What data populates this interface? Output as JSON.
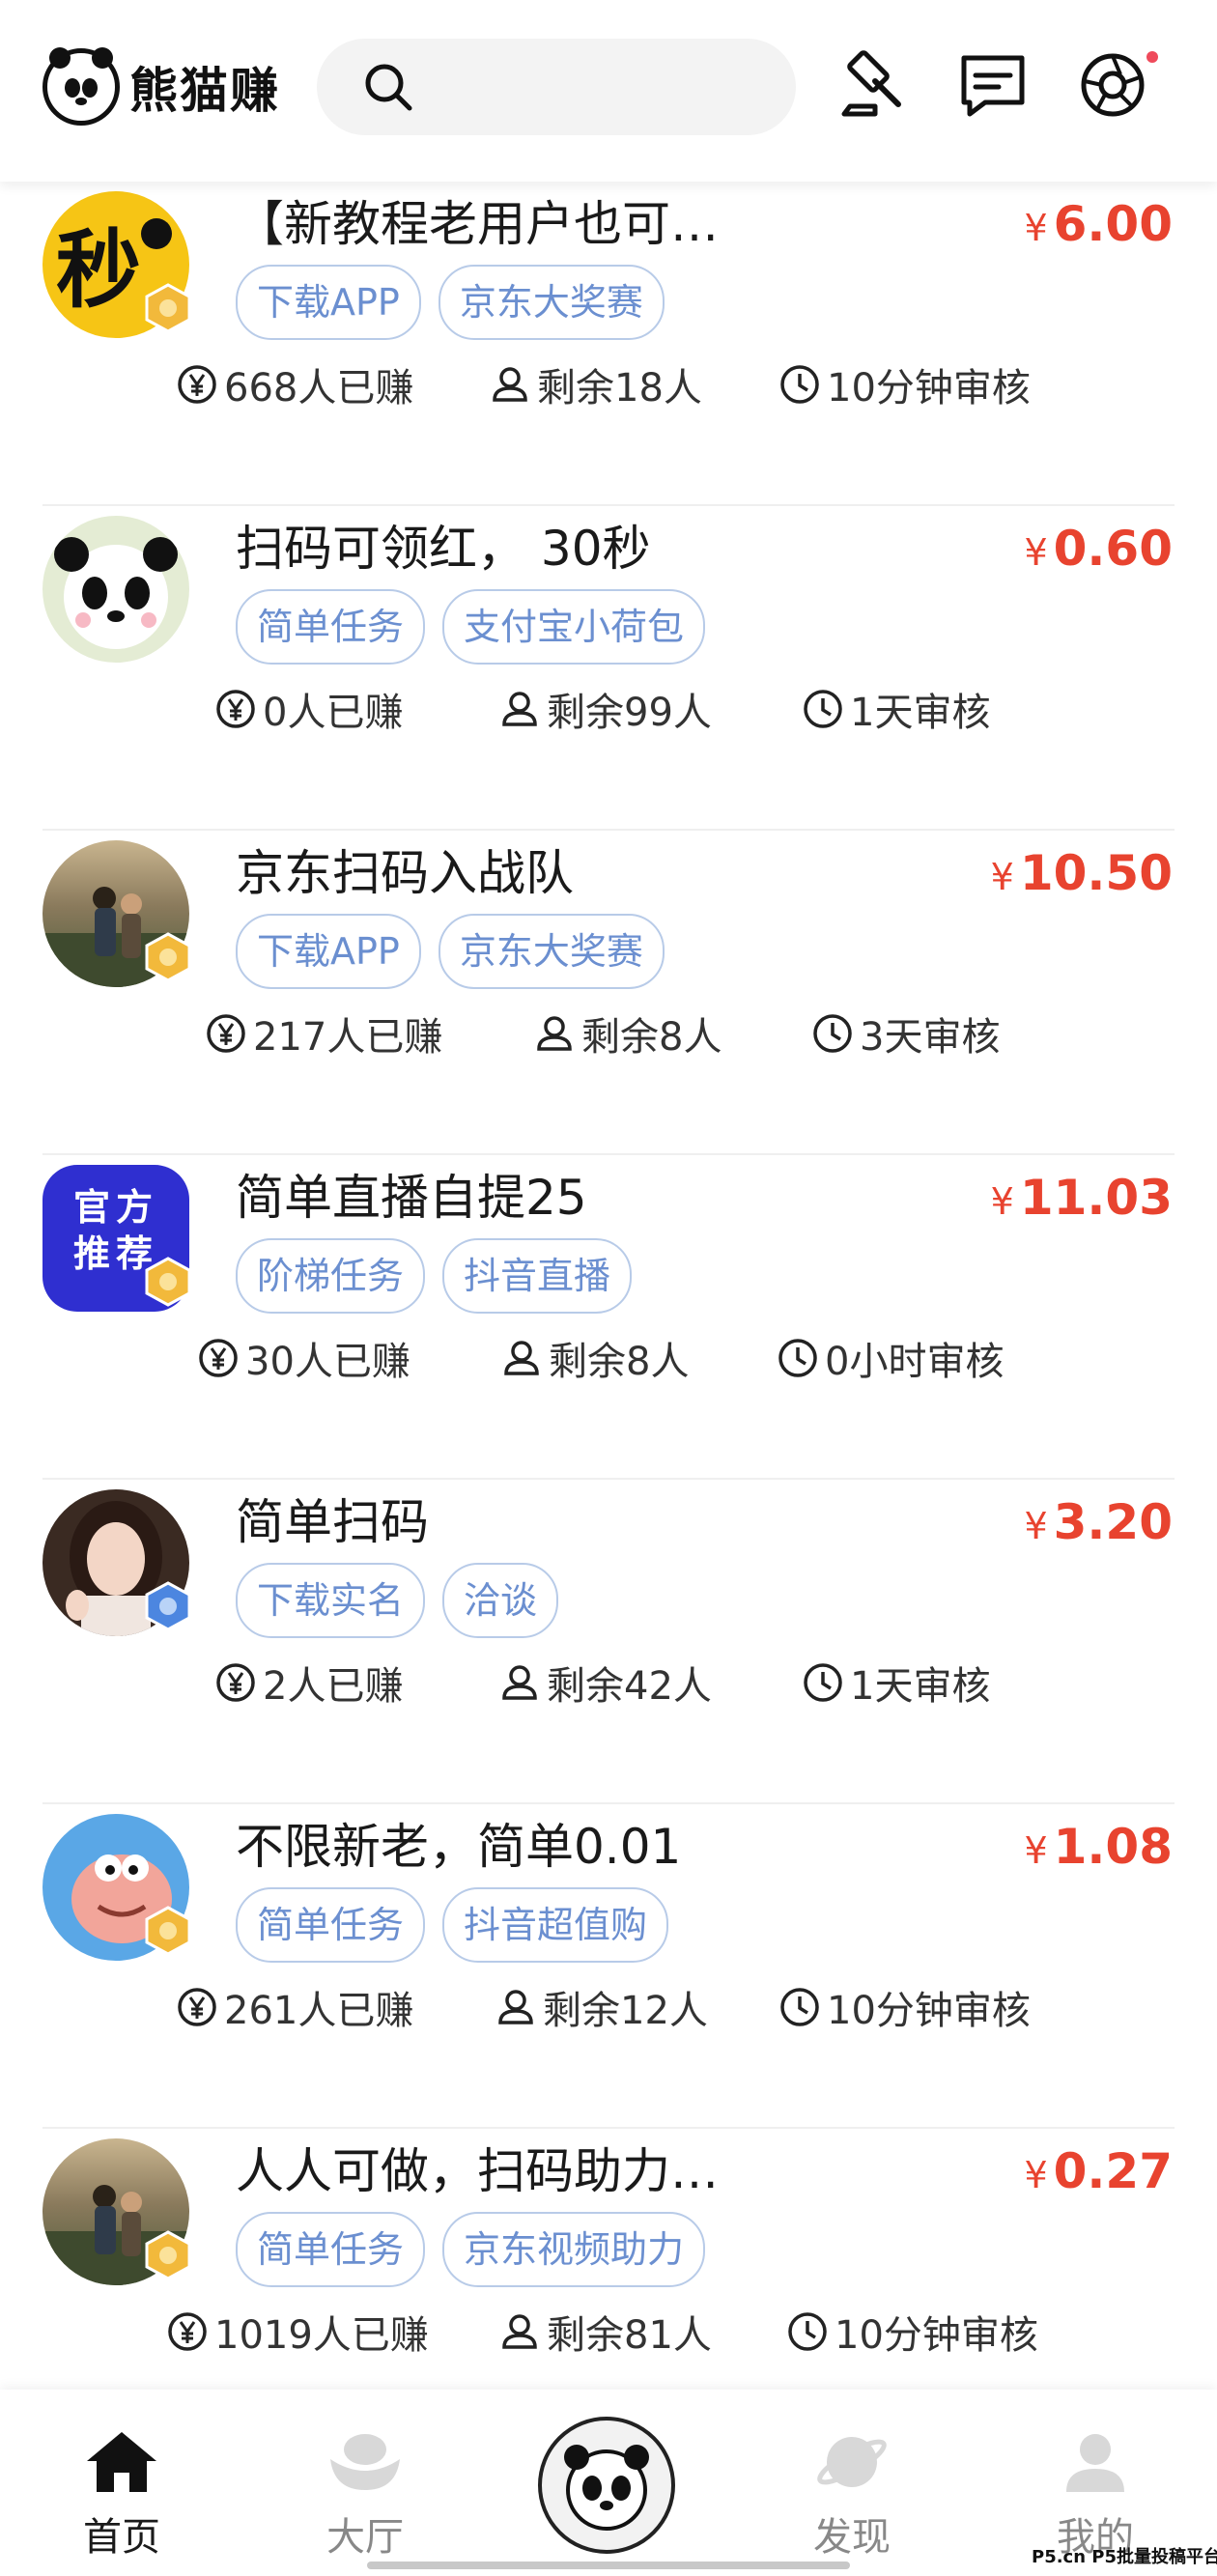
{
  "header": {
    "logo_text": "熊猫赚",
    "icons": [
      "search-icon",
      "auction-hammer-icon",
      "message-icon",
      "camera-shutter-icon"
    ],
    "notification_dot_color": "#ef4a5b"
  },
  "colors": {
    "price": "#e8432f",
    "tag_text": "#6b8fd0",
    "tag_border": "#b8cbe8"
  },
  "tasks": [
    {
      "title": "【新教程老用户也可以...",
      "currency": "¥",
      "price": "6.00",
      "tags": [
        "下载APP",
        "京东大奖赛"
      ],
      "earned": "668人已赚",
      "remaining": "剩余18人",
      "review": "10分钟审核"
    },
    {
      "title": "扫码可领红， 30秒",
      "currency": "¥",
      "price": "0.60",
      "tags": [
        "简单任务",
        "支付宝小荷包"
      ],
      "earned": "0人已赚",
      "remaining": "剩余99人",
      "review": "1天审核"
    },
    {
      "title": "京东扫码入战队",
      "currency": "¥",
      "price": "10.50",
      "tags": [
        "下载APP",
        "京东大奖赛"
      ],
      "earned": "217人已赚",
      "remaining": "剩余8人",
      "review": "3天审核"
    },
    {
      "title": "简单直播自提25",
      "currency": "¥",
      "price": "11.03",
      "tags": [
        "阶梯任务",
        "抖音直播"
      ],
      "earned": "30人已赚",
      "remaining": "剩余8人",
      "review": "0小时审核",
      "avatar_text": [
        "官方",
        "推荐"
      ]
    },
    {
      "title": "简单扫码",
      "currency": "¥",
      "price": "3.20",
      "tags": [
        "下载实名",
        "洽谈"
      ],
      "earned": "2人已赚",
      "remaining": "剩余42人",
      "review": "1天审核"
    },
    {
      "title": "不限新老，简单0.01",
      "currency": "¥",
      "price": "1.08",
      "tags": [
        "简单任务",
        "抖音超值购"
      ],
      "earned": "261人已赚",
      "remaining": "剩余12人",
      "review": "10分钟审核"
    },
    {
      "title": "人人可做，扫码助力即可",
      "currency": "¥",
      "price": "0.27",
      "tags": [
        "简单任务",
        "京东视频助力"
      ],
      "earned": "1019人已赚",
      "remaining": "剩余81人",
      "review": "10分钟审核"
    }
  ],
  "nav": [
    {
      "label": "首页",
      "icon": "home-icon",
      "active": true
    },
    {
      "label": "大厅",
      "icon": "ingot-icon",
      "active": false
    },
    {
      "label": "",
      "icon": "panda-icon",
      "active": false
    },
    {
      "label": "发现",
      "icon": "planet-icon",
      "active": false
    },
    {
      "label": "我的",
      "icon": "user-icon",
      "active": false
    }
  ],
  "watermark": "P5.cn P5批量投稿平台"
}
